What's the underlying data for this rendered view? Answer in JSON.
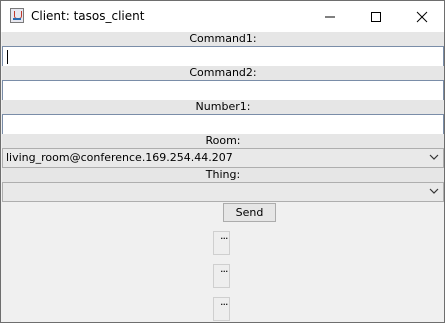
{
  "window": {
    "title": "Client: tasos_client",
    "icons": {
      "app": "java-cup-icon",
      "minimize": "minimize-icon",
      "maximize": "maximize-icon",
      "close": "close-icon"
    }
  },
  "form": {
    "command1": {
      "label": "Command1:",
      "value": ""
    },
    "command2": {
      "label": "Command2:",
      "value": ""
    },
    "number1": {
      "label": "Number1:",
      "value": ""
    },
    "room": {
      "label": "Room:",
      "selected": "living_room@conference.169.254.44.207"
    },
    "thing": {
      "label": "Thing:",
      "selected": ""
    },
    "send_label": "Send"
  },
  "extra_buttons": [
    "...",
    "...",
    "..."
  ],
  "colors": {
    "label_bg": "#e6e6e6",
    "field_border": "#7a8da8",
    "window_bg": "#f0f0f0"
  }
}
